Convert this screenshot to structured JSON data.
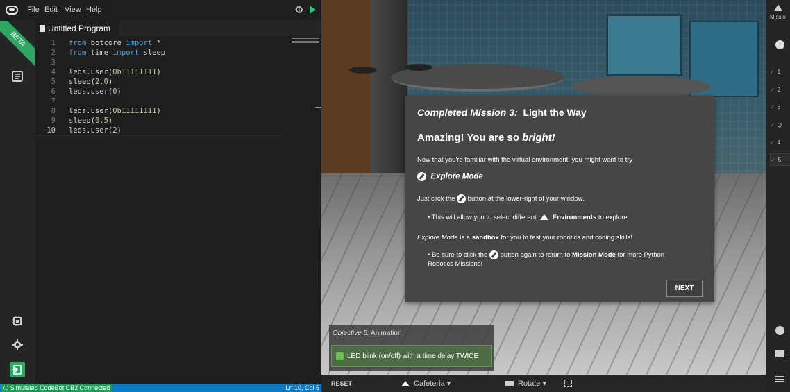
{
  "menubar": {
    "items": [
      "File",
      "Edit",
      "View",
      "Help"
    ]
  },
  "left_rail": {
    "beta_label": "BETA"
  },
  "editor": {
    "tab_title": "Untitled Program",
    "lines": [
      {
        "n": "1",
        "code": "from botcore import *"
      },
      {
        "n": "2",
        "code": "from time import sleep"
      },
      {
        "n": "3",
        "code": ""
      },
      {
        "n": "4",
        "code": "leds.user(0b11111111)"
      },
      {
        "n": "5",
        "code": "sleep(2.0)"
      },
      {
        "n": "6",
        "code": "leds.user(0)"
      },
      {
        "n": "7",
        "code": ""
      },
      {
        "n": "8",
        "code": "leds.user(0b11111111)"
      },
      {
        "n": "9",
        "code": "sleep(0.5)"
      },
      {
        "n": "10",
        "code": "leds.user(2)"
      }
    ]
  },
  "statusbar": {
    "connection": "Simulated CodeBot CB2 Connected",
    "cursor": "Ln 10, Col 5"
  },
  "dialog": {
    "title_prefix": "Completed Mission 3:",
    "title_name": "Light the Way",
    "headline_a": "Amazing! You are so",
    "headline_b": "bright!",
    "intro": "Now that you're familiar with the virtual environment, you might want to try",
    "explore_mode": "Explore Mode",
    "click_a": "Just click the",
    "click_b": "button at the lower-right of your window.",
    "bullet1_a": "This will allow you to select different",
    "bullet1_b": "Environments",
    "bullet1_c": "to explore.",
    "sandbox_a": "Explore Mode",
    "sandbox_b": "is a",
    "sandbox_c": "sandbox",
    "sandbox_d": "for you to test your robotics and coding skills!",
    "bullet2_a": "Be sure to click the",
    "bullet2_b": "button again to return to",
    "bullet2_c": "Mission Mode",
    "bullet2_d": "for more Python Robotics Missions!",
    "next_label": "NEXT"
  },
  "objective": {
    "title_a": "Objective 5:",
    "title_b": "Animation",
    "task": "LED blink (on/off) with a time delay TWICE"
  },
  "sim_toolbar": {
    "reset": "RESET",
    "environment": "Cafeteria",
    "camera": "Rotate"
  },
  "mission_rail": {
    "title": "Missio",
    "items": [
      "1",
      "2",
      "3",
      "Q",
      "4",
      "5"
    ]
  }
}
